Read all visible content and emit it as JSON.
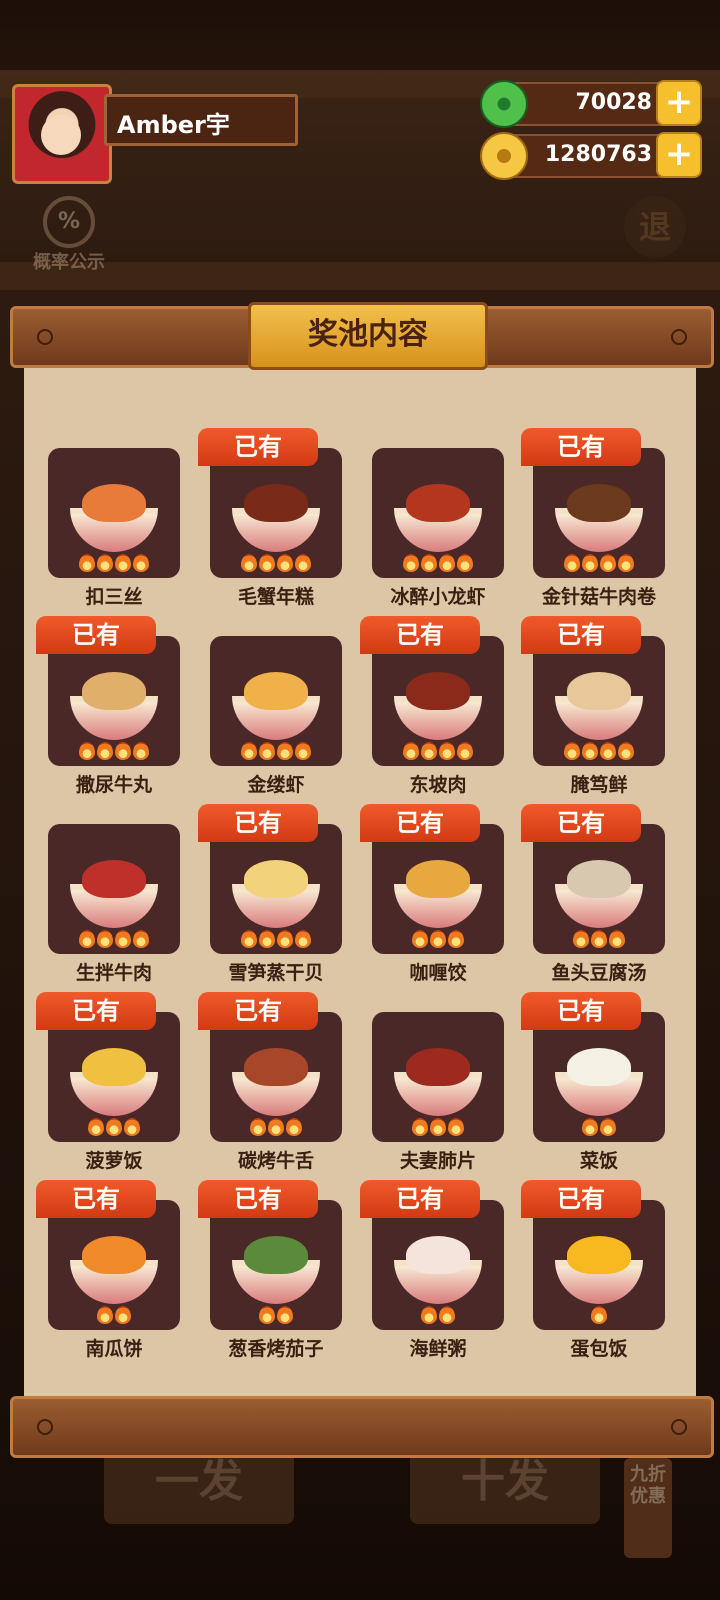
{
  "player": {
    "name": "Amber宇"
  },
  "currency": {
    "jade": "70028",
    "gold": "1280763",
    "plus": "+"
  },
  "probability": {
    "icon": "%",
    "label": "概率公示"
  },
  "exit": {
    "label": "退"
  },
  "panel": {
    "title": "奖池内容"
  },
  "owned_label": "已有",
  "dishes": [
    {
      "name": "扣三丝",
      "owned": false,
      "fires": 4
    },
    {
      "name": "毛蟹年糕",
      "owned": true,
      "fires": 4
    },
    {
      "name": "冰醉小龙虾",
      "owned": false,
      "fires": 4
    },
    {
      "name": "金针菇牛肉卷",
      "owned": true,
      "fires": 4
    },
    {
      "name": "撒尿牛丸",
      "owned": true,
      "fires": 4
    },
    {
      "name": "金缕虾",
      "owned": false,
      "fires": 4
    },
    {
      "name": "东坡肉",
      "owned": true,
      "fires": 4
    },
    {
      "name": "腌笃鲜",
      "owned": true,
      "fires": 4
    },
    {
      "name": "生拌牛肉",
      "owned": false,
      "fires": 4
    },
    {
      "name": "雪笋蒸干贝",
      "owned": true,
      "fires": 4
    },
    {
      "name": "咖喱饺",
      "owned": true,
      "fires": 3
    },
    {
      "name": "鱼头豆腐汤",
      "owned": true,
      "fires": 3
    },
    {
      "name": "菠萝饭",
      "owned": true,
      "fires": 3
    },
    {
      "name": "碳烤牛舌",
      "owned": true,
      "fires": 3
    },
    {
      "name": "夫妻肺片",
      "owned": false,
      "fires": 3
    },
    {
      "name": "菜饭",
      "owned": true,
      "fires": 2
    },
    {
      "name": "南瓜饼",
      "owned": true,
      "fires": 2
    },
    {
      "name": "葱香烤茄子",
      "owned": true,
      "fires": 2
    },
    {
      "name": "海鲜粥",
      "owned": true,
      "fires": 2
    },
    {
      "name": "蛋包饭",
      "owned": true,
      "fires": 1
    }
  ],
  "food_colors": [
    "#e87a3a",
    "#7a2a18",
    "#b5361e",
    "#6b3a1c",
    "#e0b06a",
    "#f0b04a",
    "#8a2a1a",
    "#e8c89a",
    "#c0302a",
    "#f2d27a",
    "#e8a840",
    "#d8c8b0",
    "#f0c040",
    "#a8462a",
    "#9c2a1e",
    "#f4f0e4",
    "#f08a2a",
    "#5a8a3a",
    "#f4e4dc",
    "#f8b820"
  ],
  "bottom": {
    "single": "一发",
    "ten": "十发",
    "discount": "九折优惠"
  }
}
